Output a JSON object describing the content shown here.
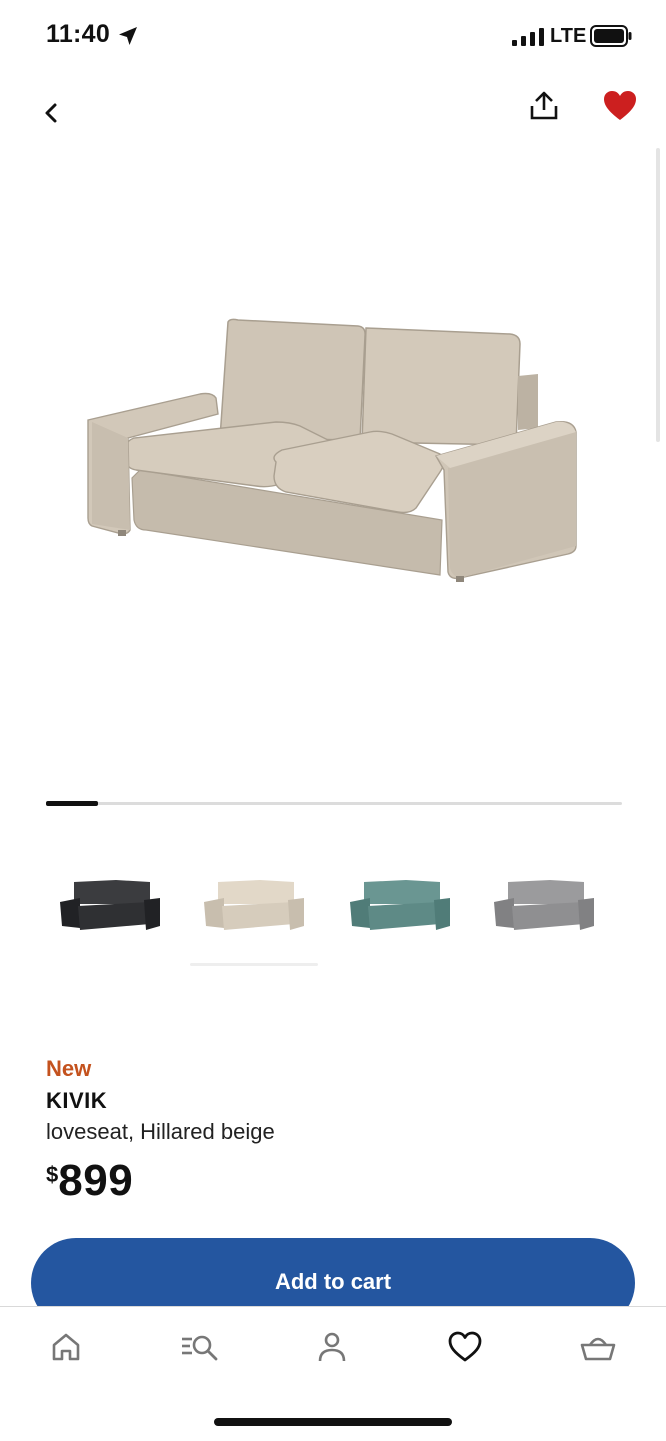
{
  "status_bar": {
    "time": "11:40",
    "network": "LTE"
  },
  "nav": {
    "back_icon": "chevron-left-icon",
    "share_icon": "share-icon",
    "favorite_icon": "heart-filled-icon",
    "favorite_color": "#cc1f1f"
  },
  "carousel": {
    "progress": 0.09
  },
  "colors": {
    "options": [
      {
        "name": "dark-gray",
        "hex": "#2f3033"
      },
      {
        "name": "beige",
        "hex": "#d6ccbc"
      },
      {
        "name": "teal",
        "hex": "#5e8a86"
      },
      {
        "name": "gray",
        "hex": "#8f8f91"
      }
    ],
    "selected_index": 1
  },
  "product": {
    "badge": "New",
    "name": "KIVIK",
    "description": "loveseat, Hillared beige",
    "currency": "$",
    "price": "899",
    "badge_color": "#c4521e"
  },
  "actions": {
    "add_to_cart": "Add to cart",
    "brand_color": "#2456a0"
  },
  "tab_bar": {
    "tabs": [
      {
        "icon": "home-icon"
      },
      {
        "icon": "search-list-icon"
      },
      {
        "icon": "profile-icon"
      },
      {
        "icon": "heart-icon",
        "active": true
      },
      {
        "icon": "basket-icon"
      }
    ]
  }
}
